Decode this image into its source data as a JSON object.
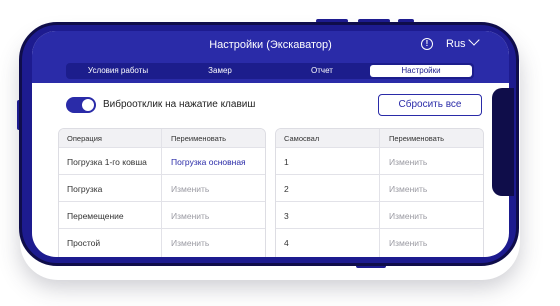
{
  "header": {
    "title": "Настройки (Экскаватор)",
    "language": "Rus"
  },
  "tabs": [
    {
      "label": "Условия работы"
    },
    {
      "label": "Замер"
    },
    {
      "label": "Отчет"
    },
    {
      "label": "Настройки"
    }
  ],
  "settings": {
    "vibro_label": "Виброотклик на нажатие клавиш",
    "vibro_enabled": true,
    "reset_label": "Сбросить все"
  },
  "operations_table": {
    "headers": [
      "Операция",
      "Переименовать"
    ],
    "rows": [
      {
        "operation": "Погрузка 1-го ковша",
        "rename": "Погрузка основная"
      },
      {
        "operation": "Погрузка",
        "rename": "Изменить"
      },
      {
        "operation": "Перемещение",
        "rename": "Изменить"
      },
      {
        "operation": "Простой",
        "rename": "Изменить"
      }
    ]
  },
  "trucks_table": {
    "headers": [
      "Самосвал",
      "Переименовать"
    ],
    "rows": [
      {
        "truck": "1",
        "rename": "Изменить"
      },
      {
        "truck": "2",
        "rename": "Изменить"
      },
      {
        "truck": "3",
        "rename": "Изменить"
      },
      {
        "truck": "4",
        "rename": "Изменить"
      }
    ]
  },
  "colors": {
    "accent": "#2a2ba8",
    "frame": "#1d1b8f",
    "muted_text": "#9b9ba3"
  }
}
